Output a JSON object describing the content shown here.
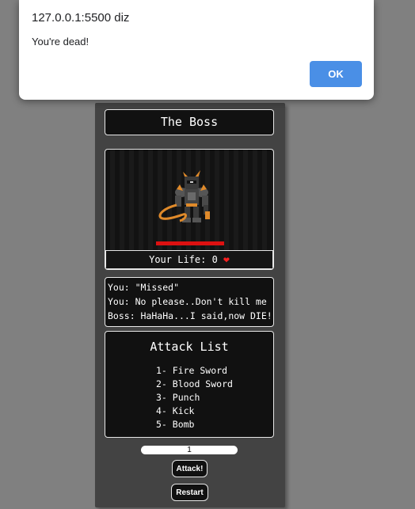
{
  "alert": {
    "origin": "127.0.0.1:5500 diz",
    "message": "You're dead!",
    "ok_label": "OK"
  },
  "game": {
    "title": "The Boss",
    "player_life_label": "Your Life: 0",
    "player_life_value": 0,
    "heart_icon": "heart-icon",
    "boss_health_fraction": 1.0,
    "colors": {
      "panel": "#434343",
      "box": "#111111",
      "boss_health": "#dd1111",
      "heart": "#ff2020"
    },
    "log": [
      "You: \"Missed\"",
      "You: No please..Don't kill me !",
      "Boss: HaHaHa...I said,now DIE!"
    ],
    "attack_list_title": "Attack List",
    "attacks": [
      "1- Fire Sword",
      "2- Blood Sword",
      "3- Punch",
      "4- Kick",
      "5- Bomb"
    ],
    "attack_input_value": "1",
    "attack_button": "Attack!",
    "restart_button": "Restart"
  }
}
